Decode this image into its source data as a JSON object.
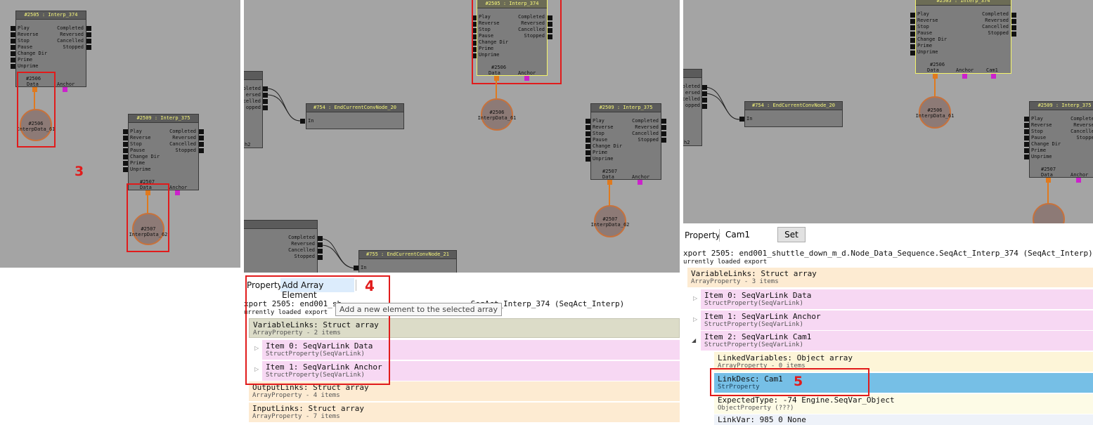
{
  "nodes": {
    "interp374": {
      "title": "#2505 : Interp_374",
      "inputs": [
        "Play",
        "Reverse",
        "Stop",
        "Pause",
        "Change Dir",
        "Prime",
        "Unprime"
      ],
      "outputs": [
        "Completed",
        "Reversed",
        "Cancelled",
        "Stopped"
      ],
      "var_id": "#2506",
      "var_data": "Data",
      "var_anchor": "Anchor",
      "var_cam": "Cam1"
    },
    "interp375": {
      "title": "#2509 : Interp_375",
      "inputs": [
        "Play",
        "Reverse",
        "Stop",
        "Pause",
        "Change Dir",
        "Prime",
        "Unprime"
      ],
      "outputs": [
        "Completed",
        "Reversed",
        "Cancelled",
        "Stopped"
      ],
      "var_id": "#2507",
      "var_data": "Data",
      "var_anchor": "Anchor"
    },
    "data61": {
      "id": "#2506",
      "name": "InterpData_61"
    },
    "data62": {
      "id": "#2507",
      "name": "InterpData_62"
    },
    "end20": {
      "title": "#754 : EndCurrentConvNode_20",
      "input": "In"
    },
    "end21": {
      "title": "#755 : EndCurrentConvNode_21",
      "input": "In"
    },
    "partial_left": {
      "outputs": [
        "Completed",
        "Reversed",
        "Cancelled",
        "Stopped"
      ],
      "suffix": "h2"
    },
    "partial_left_short": {
      "outputs": [
        "pleted",
        "ersed",
        "celled",
        "opped"
      ]
    },
    "partial_left_p3": {
      "outputs": [
        "pleted",
        "ersed",
        "celled",
        "opped"
      ]
    }
  },
  "annotations": {
    "label3": "3",
    "label4": "4",
    "label5": "5"
  },
  "panel2": {
    "toolbar_property": "Property",
    "toolbar_add": "Add Array Element",
    "tooltip": "Add a new element to the selected array",
    "export_line": "xport 2505: end001_sh",
    "export_tail": ".SeqAct_Interp_374 (SeqAct_Interp)",
    "loaded": "urrently loaded export",
    "rows": [
      {
        "title": "VariableLinks: Struct array",
        "sub": "ArrayProperty - 2 items"
      },
      {
        "title": "Item 0: SeqVarLink Data",
        "sub": "StructProperty(SeqVarLink)"
      },
      {
        "title": "Item 1: SeqVarLink Anchor",
        "sub": "StructProperty(SeqVarLink)"
      },
      {
        "title": "OutputLinks: Struct array",
        "sub": "ArrayProperty - 4 items"
      },
      {
        "title": "InputLinks: Struct array",
        "sub": "ArrayProperty - 7 items"
      }
    ]
  },
  "panel3": {
    "toolbar_property": "Property",
    "input_value": "Cam1",
    "set_label": "Set",
    "export_line": "xport 2505: end001_shuttle_down_m_d.Node_Data_Sequence.SeqAct_Interp_374 (SeqAct_Interp)",
    "loaded": "urrently loaded export",
    "rows": [
      {
        "title": "VariableLinks: Struct array",
        "sub": "ArrayProperty - 3 items"
      },
      {
        "title": "Item 0: SeqVarLink Data",
        "sub": "StructProperty(SeqVarLink)"
      },
      {
        "title": "Item 1: SeqVarLink Anchor",
        "sub": "StructProperty(SeqVarLink)"
      },
      {
        "title": "Item 2: SeqVarLink Cam1",
        "sub": "StructProperty(SeqVarLink)"
      },
      {
        "title": "LinkedVariables: Object array",
        "sub": "ArrayProperty - 0 items"
      },
      {
        "title": "LinkDesc: Cam1",
        "sub": "StrProperty"
      },
      {
        "title": "ExpectedType: -74 Engine.SeqVar_Object",
        "sub": "ObjectProperty (???)"
      },
      {
        "title": "LinkVar: 985 0 None",
        "sub": ""
      }
    ]
  },
  "colors": {
    "canvas": "#a4a4a4",
    "node_body": "#7d7d7d",
    "node_title_text": "#f6f67a",
    "data_port": "#e07a1e",
    "anchor_port": "#cc22cc",
    "annotation": "#e11b1b",
    "row_array": "#dcdcc8",
    "row_struct": "#f7d8f3",
    "row_outputs": "#fdebd2",
    "row_object": "#fdf5d8",
    "row_selected": "#76bfe6"
  }
}
